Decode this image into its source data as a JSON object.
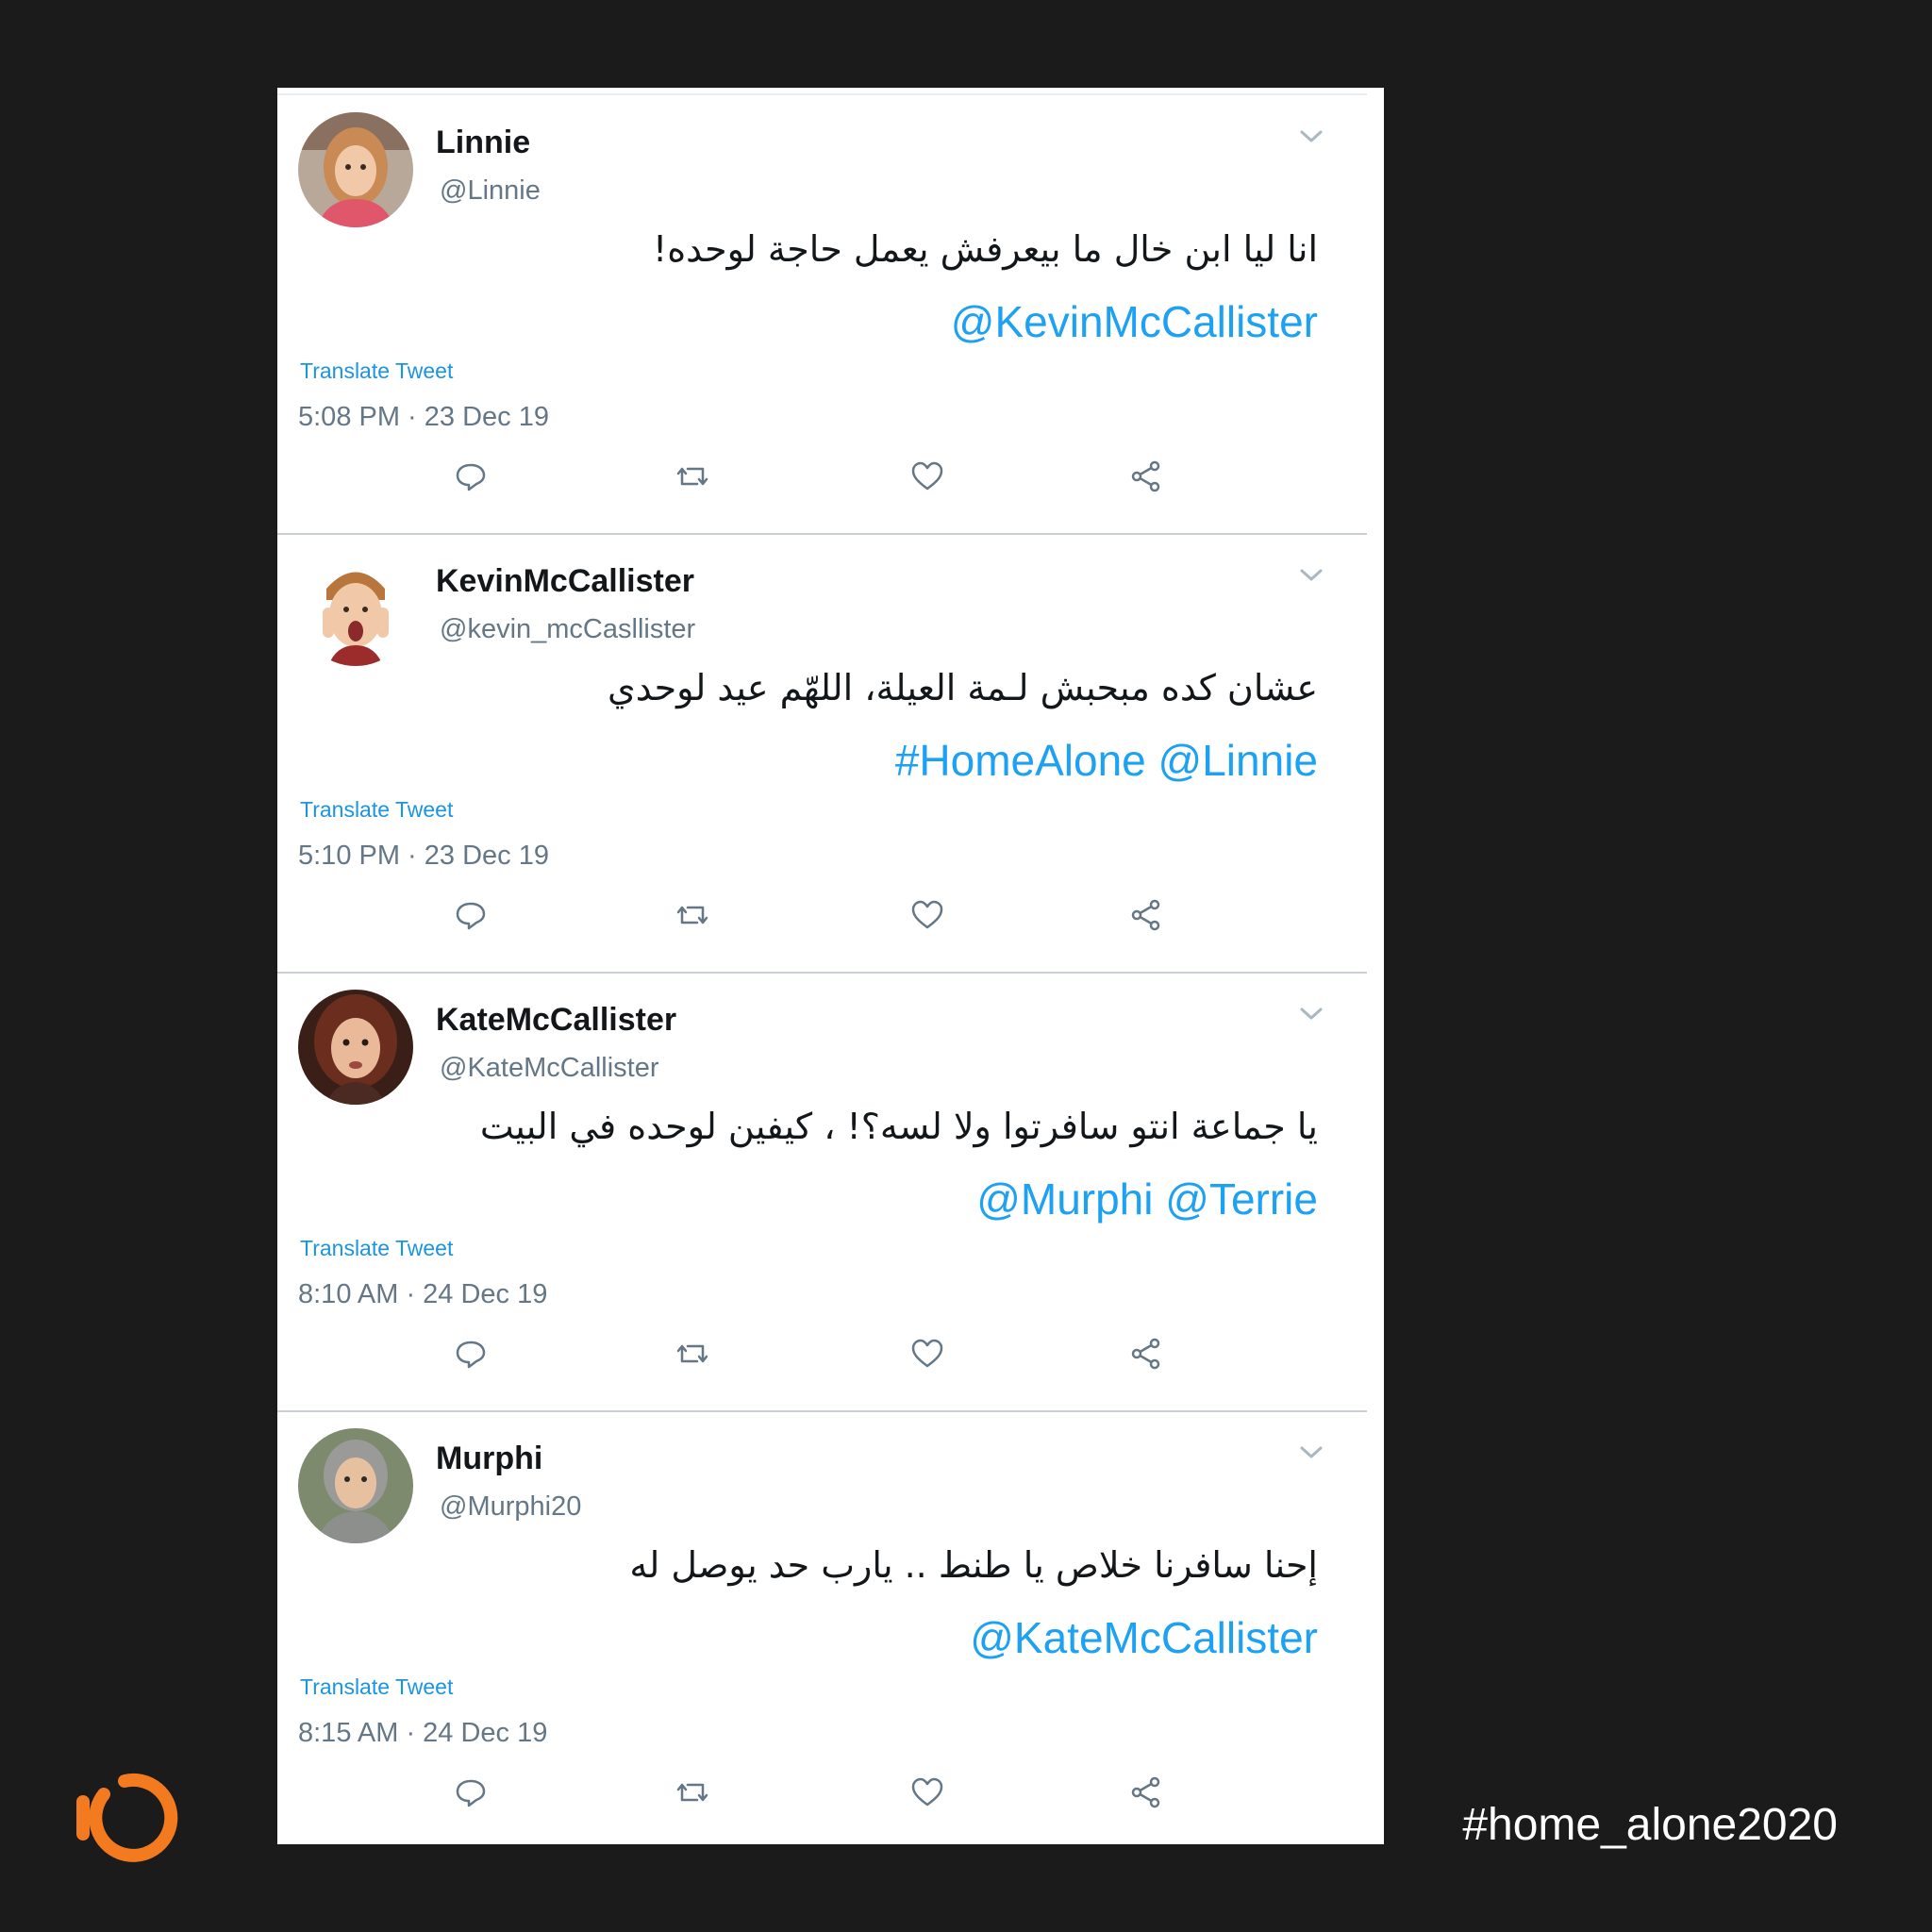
{
  "colors": {
    "background": "#1c1b1b",
    "card": "#ffffff",
    "link": "#1da1f2",
    "muted": "#657786",
    "logo_orange": "#f47a20"
  },
  "tweets": [
    {
      "name": "Linnie",
      "handle": "@Linnie",
      "text": "انا ليا ابن خال ما بيعرفش يعمل حاجة لوحده!",
      "mentions": "@KevinMcCallister",
      "translate": "Translate Tweet",
      "time": "5:08 PM · 23 Dec 19",
      "avatar_icon": "girl-avatar"
    },
    {
      "name": "KevinMcCallister",
      "handle": "@kevin_mcCasllister",
      "text": "عشان كده مبحبش لـمة العيلة، اللهّم عيد لوحدي",
      "mentions": "#HomeAlone @Linnie",
      "translate": "Translate Tweet",
      "time": "5:10 PM · 23 Dec 19",
      "avatar_icon": "boy-screaming-avatar"
    },
    {
      "name": "KateMcCallister",
      "handle": "@KateMcCallister",
      "text": "يا جماعة انتو سافرتوا ولا لسه؟! ، كيفين لوحده في البيت",
      "mentions": "@Murphi @Terrie",
      "translate": "Translate Tweet",
      "time": "8:10 AM · 24 Dec 19",
      "avatar_icon": "woman-avatar"
    },
    {
      "name": "Murphi",
      "handle": "@Murphi20",
      "text": "إحنا سافرنا خلاص يا طنط .. يارب حد يوصل له",
      "mentions": "@KateMcCallister",
      "translate": "Translate Tweet",
      "time": "8:15 AM · 24 Dec 19",
      "avatar_icon": "boy-hooded-avatar"
    }
  ],
  "actions": [
    "reply-icon",
    "retweet-icon",
    "like-icon",
    "share-icon"
  ],
  "footer": {
    "hashtag": "#home_alone2020",
    "logo_icon": "power-logo-icon"
  }
}
